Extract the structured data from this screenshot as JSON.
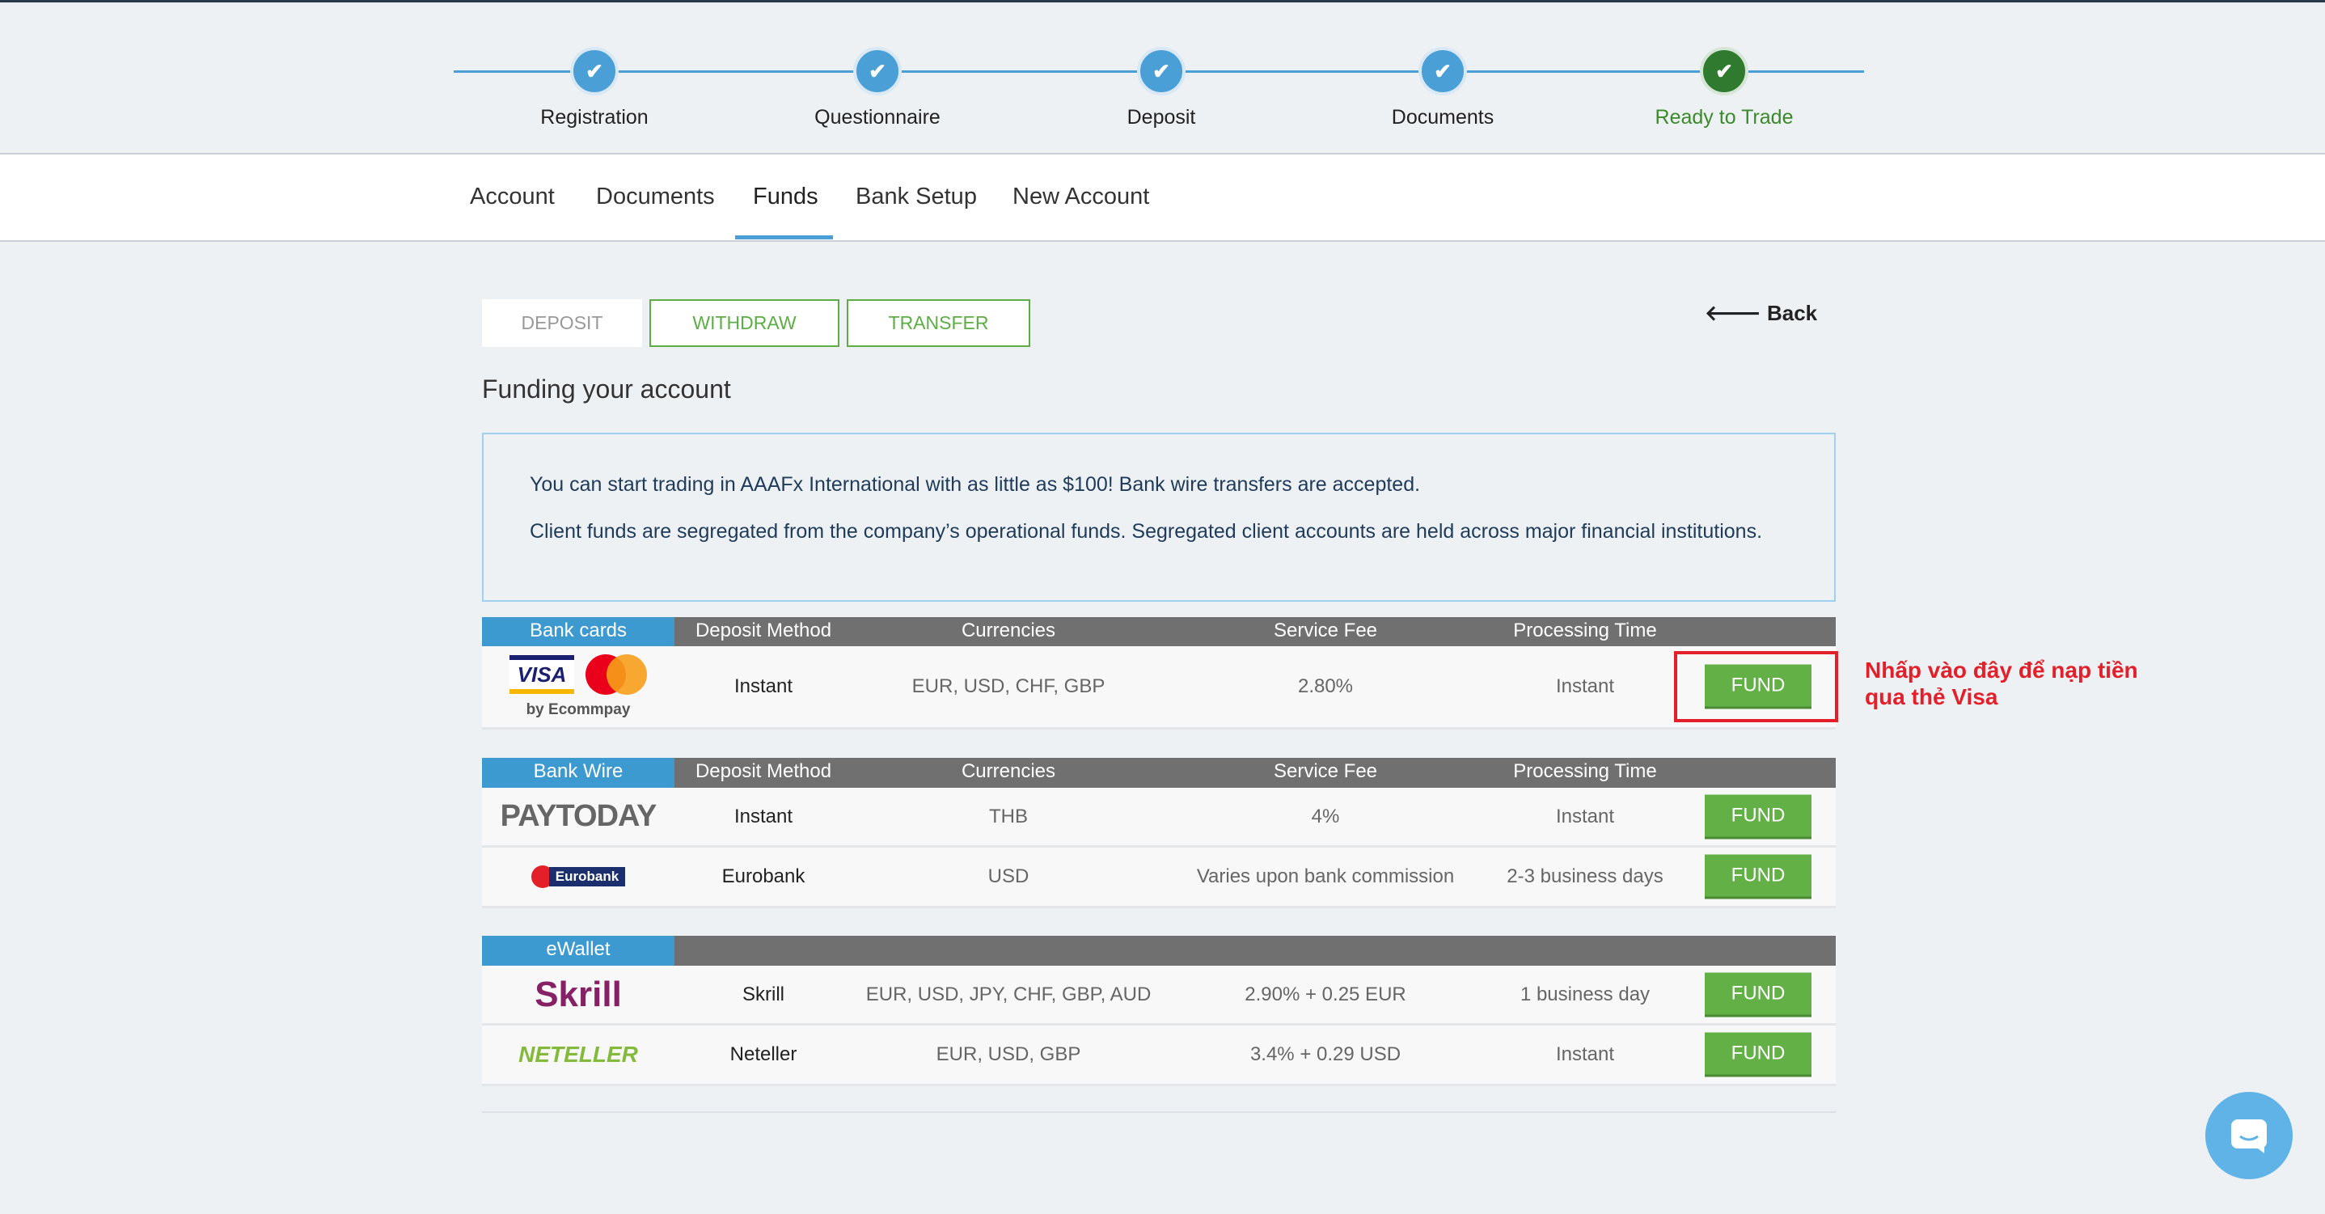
{
  "stepper": [
    {
      "label": "Registration",
      "status": "done"
    },
    {
      "label": "Questionnaire",
      "status": "done"
    },
    {
      "label": "Deposit",
      "status": "done"
    },
    {
      "label": "Documents",
      "status": "done"
    },
    {
      "label": "Ready to Trade",
      "status": "complete"
    }
  ],
  "nav": {
    "items": [
      "Account",
      "Documents",
      "Funds",
      "Bank Setup",
      "New Account"
    ],
    "active": "Funds"
  },
  "tabs": {
    "deposit": "DEPOSIT",
    "withdraw": "WITHDRAW",
    "transfer": "TRANSFER"
  },
  "back_label": "Back",
  "page_title": "Funding your account",
  "info": {
    "line1": "You can start trading in AAAFx International with as little as $100! Bank wire transfers are accepted.",
    "line2": "Client funds are segregated from the company’s operational funds. Segregated client accounts are held across major financial institutions."
  },
  "columns": {
    "method": "Deposit Method",
    "currencies": "Currencies",
    "fee": "Service Fee",
    "time": "Processing Time"
  },
  "fund_label": "FUND",
  "sections": [
    {
      "category": "Bank cards",
      "rows": [
        {
          "logo": "VISA / mastercard",
          "logo_sub": "by Ecommpay",
          "method": "Instant",
          "currencies": "EUR, USD, CHF, GBP",
          "fee": "2.80%",
          "time": "Instant"
        }
      ]
    },
    {
      "category": "Bank Wire",
      "rows": [
        {
          "logo": "PAYTODAY",
          "method": "Instant",
          "currencies": "THB",
          "fee": "4%",
          "time": "Instant"
        },
        {
          "logo": "Eurobank",
          "method": "Eurobank",
          "currencies": "USD",
          "fee": "Varies upon bank commission",
          "time": "2-3 business days"
        }
      ]
    },
    {
      "category": "eWallet",
      "rows": [
        {
          "logo": "Skrill",
          "method": "Skrill",
          "currencies": "EUR, USD, JPY, CHF, GBP, AUD",
          "fee": "2.90% + 0.25 EUR",
          "time": "1 business day"
        },
        {
          "logo": "NETELLER",
          "method": "Neteller",
          "currencies": "EUR, USD, GBP",
          "fee": "3.4% + 0.29 USD",
          "time": "Instant"
        }
      ]
    }
  ],
  "annotation": {
    "line1": "Nhấp vào đây để nạp tiền",
    "line2": "qua thẻ Visa"
  },
  "colors": {
    "accent": "#4a9fd6",
    "fund": "#63b046",
    "annotation": "#e3202a"
  }
}
